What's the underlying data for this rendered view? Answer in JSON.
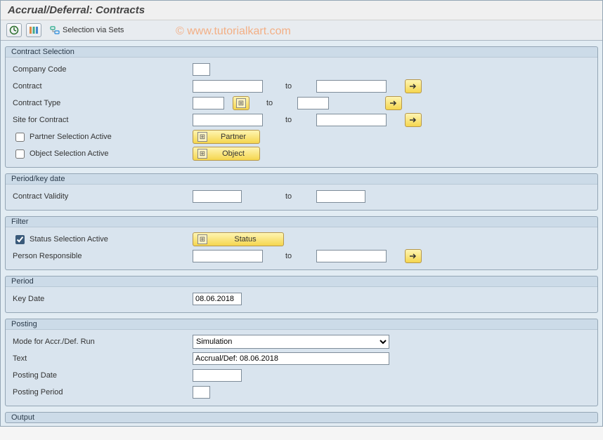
{
  "title": "Accrual/Deferral: Contracts",
  "toolbar": {
    "selection_via_sets": "Selection via Sets"
  },
  "watermark": "©  www.tutorialkart.com",
  "contract_selection": {
    "title": "Contract Selection",
    "company_code_label": "Company Code",
    "company_code_value": "",
    "contract_label": "Contract",
    "contract_from": "",
    "contract_to": "",
    "contract_type_label": "Contract Type",
    "contract_type_from": "",
    "contract_type_to": "",
    "site_label": "Site for Contract",
    "site_from": "",
    "site_to": "",
    "partner_sel_label": "Partner Selection Active",
    "partner_sel_checked": false,
    "partner_btn": "Partner",
    "object_sel_label": "Object Selection Active",
    "object_sel_checked": false,
    "object_btn": "Object",
    "to": "to"
  },
  "period_key": {
    "title": "Period/key date",
    "validity_label": "Contract Validity",
    "validity_from": "",
    "validity_to": "",
    "to": "to"
  },
  "filter": {
    "title": "Filter",
    "status_sel_label": "Status Selection Active",
    "status_sel_checked": true,
    "status_btn": "Status",
    "person_label": "Person Responsible",
    "person_from": "",
    "person_to": "",
    "to": "to"
  },
  "period": {
    "title": "Period",
    "keydate_label": "Key Date",
    "keydate_value": "08.06.2018"
  },
  "posting": {
    "title": "Posting",
    "mode_label": "Mode for Accr./Def. Run",
    "mode_value": "Simulation",
    "text_label": "Text",
    "text_value": "Accrual/Def: 08.06.2018",
    "pdate_label": "Posting Date",
    "pdate_value": "",
    "pperiod_label": "Posting Period",
    "pperiod_value": ""
  },
  "output": {
    "title": "Output"
  }
}
